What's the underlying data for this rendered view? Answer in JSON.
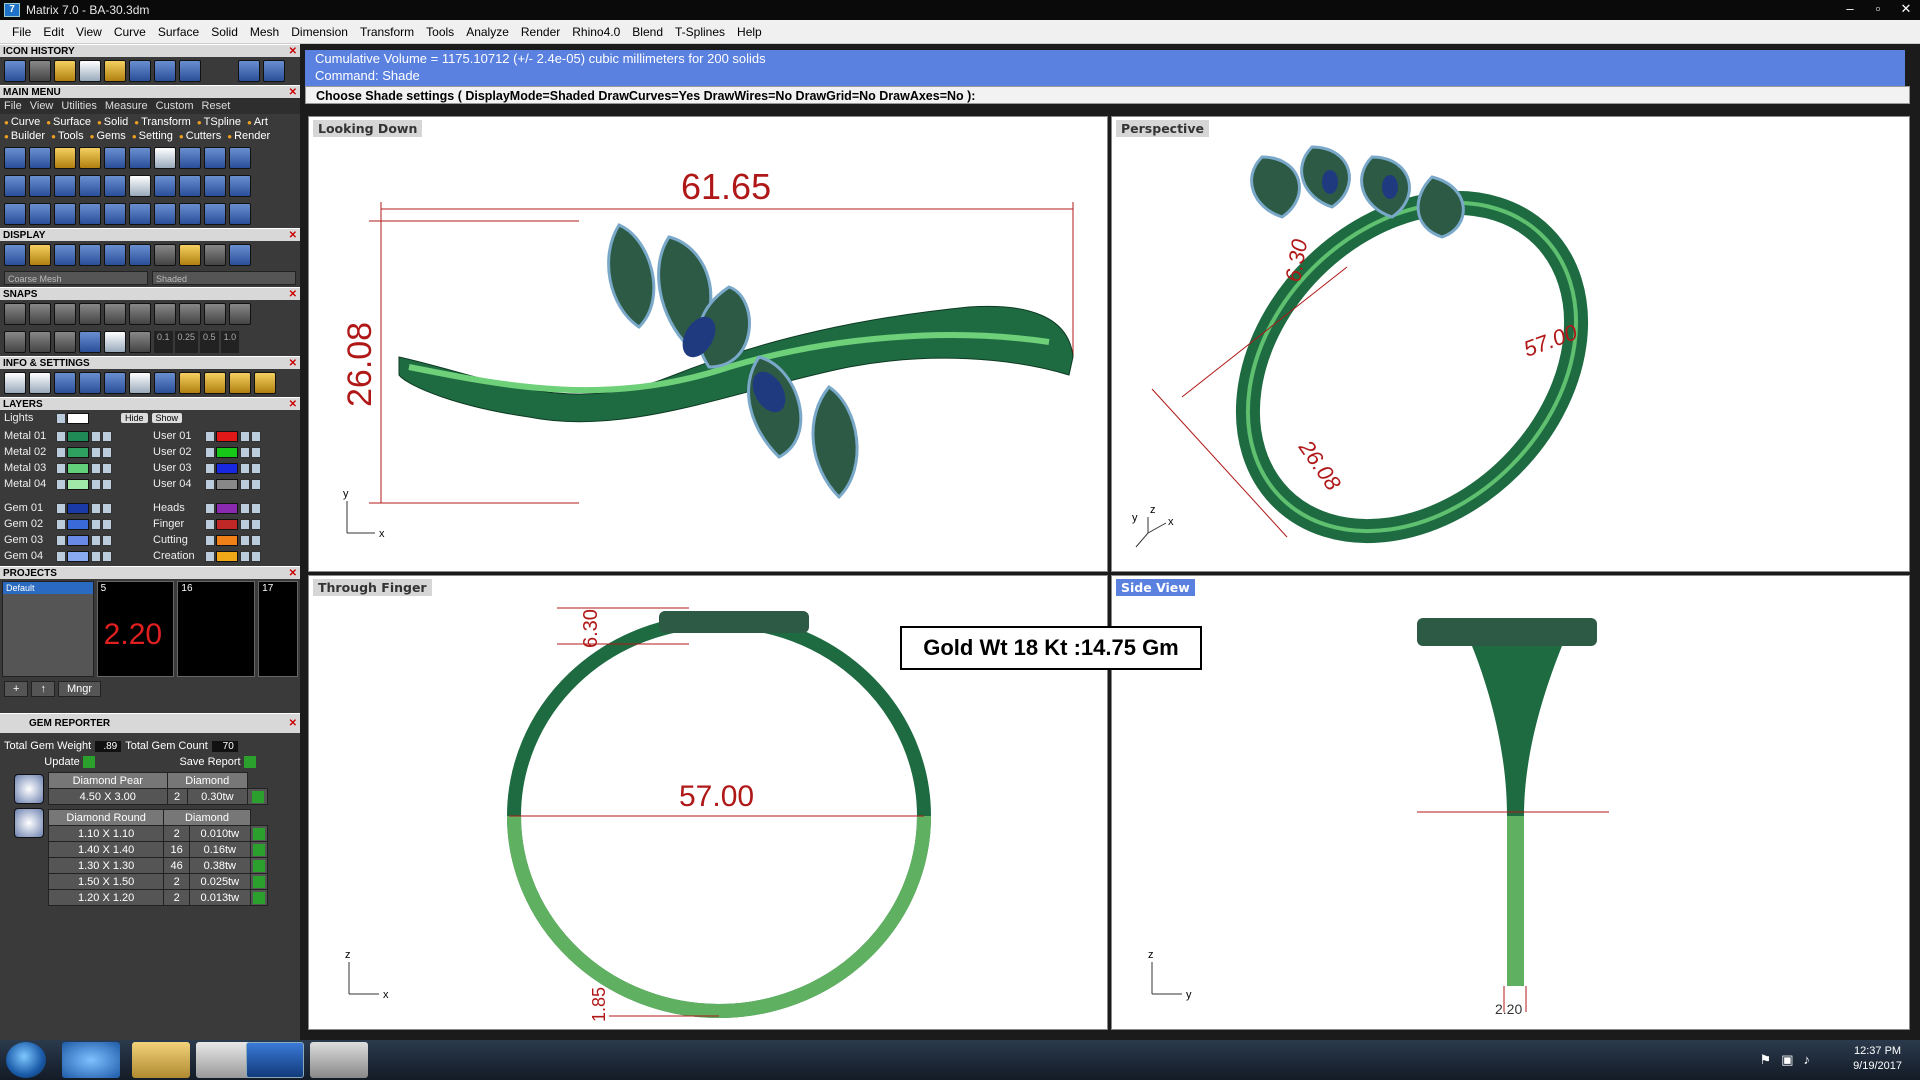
{
  "window": {
    "title": "Matrix 7.0 - BA-30.3dm",
    "icon": "matrix-app-icon"
  },
  "menu": [
    "File",
    "Edit",
    "View",
    "Curve",
    "Surface",
    "Solid",
    "Mesh",
    "Dimension",
    "Transform",
    "Tools",
    "Analyze",
    "Render",
    "Rhino4.0",
    "Blend",
    "T-Splines",
    "Help"
  ],
  "left": {
    "icon_history": "ICON HISTORY",
    "main_menu": "MAIN MENU",
    "submenu": [
      "File",
      "View",
      "Utilities",
      "Measure",
      "Custom",
      "Reset"
    ],
    "categories": [
      "Curve",
      "Surface",
      "Solid",
      "Transform",
      "TSpline",
      "Art",
      "Builder",
      "Tools",
      "Gems",
      "Setting",
      "Cutters",
      "Render"
    ],
    "display": "DISPLAY",
    "display_mesh": "Coarse Mesh",
    "display_mode": "Shaded",
    "snaps": "SNAPS",
    "snap_values": [
      "0.1",
      "0.25",
      "0.5",
      "1.0"
    ],
    "info": "INFO & SETTINGS",
    "layers": "LAYERS",
    "lights": "Lights",
    "hide": "Hide",
    "show": "Show",
    "layers_left": [
      {
        "name": "Metal 01",
        "color": "#1f8a55"
      },
      {
        "name": "Metal 02",
        "color": "#2ea060"
      },
      {
        "name": "Metal 03",
        "color": "#62d07a"
      },
      {
        "name": "Metal 04",
        "color": "#a0e8a8"
      },
      {
        "name": "Gem 01",
        "color": "#1a3aa8"
      },
      {
        "name": "Gem 02",
        "color": "#3a6ad8"
      },
      {
        "name": "Gem 03",
        "color": "#6a8ae8"
      },
      {
        "name": "Gem 04",
        "color": "#8aaaf0"
      }
    ],
    "layers_right": [
      {
        "name": "User 01",
        "color": "#e01818"
      },
      {
        "name": "User 02",
        "color": "#18c818"
      },
      {
        "name": "User 03",
        "color": "#1828e0"
      },
      {
        "name": "User 04",
        "color": "#888888"
      },
      {
        "name": "Heads",
        "color": "#8a2ab0"
      },
      {
        "name": "Finger",
        "color": "#c02828"
      },
      {
        "name": "Cutting",
        "color": "#f08018"
      },
      {
        "name": "Creation",
        "color": "#f0a818"
      }
    ],
    "projects": "PROJECTS",
    "project_default": "Default",
    "thumbs": [
      "5",
      "16",
      "17"
    ],
    "thumb_value": "2.20",
    "mngr": "Mngr",
    "gem_reporter": "GEM REPORTER",
    "total_weight_label": "Total Gem Weight",
    "total_weight": ".89",
    "total_count_label": "Total Gem Count",
    "total_count": "70",
    "update": "Update",
    "save_report": "Save Report",
    "pear": {
      "shape": "Diamond Pear",
      "type": "Diamond",
      "rows": [
        [
          "4.50 X 3.00",
          "2",
          "0.30tw"
        ]
      ]
    },
    "round": {
      "shape": "Diamond Round",
      "type": "Diamond",
      "rows": [
        [
          "1.10 X 1.10",
          "2",
          "0.010tw"
        ],
        [
          "1.40 X 1.40",
          "16",
          "0.16tw"
        ],
        [
          "1.30 X 1.30",
          "46",
          "0.38tw"
        ],
        [
          "1.50 X 1.50",
          "2",
          "0.025tw"
        ],
        [
          "1.20 X 1.20",
          "2",
          "0.013tw"
        ]
      ]
    }
  },
  "command": {
    "line1": "Cumulative Volume = 1175.10712 (+/- 2.4e-05) cubic millimeters for 200 solids",
    "line2": "Command: Shade",
    "prompt": "Choose Shade settings ( DisplayMode=Shaded  DrawCurves=Yes  DrawWires=No  DrawGrid=No  DrawAxes=No ):"
  },
  "viewports": {
    "top_left": {
      "label": "Looking Down",
      "width_dim": "61.65",
      "height_dim": "26.08",
      "axis_y": "y",
      "axis_x": "x"
    },
    "top_right": {
      "label": "Perspective",
      "dim_a": "6.30",
      "dim_b": "57.00",
      "dim_c": "26.08",
      "axis_y": "y",
      "axis_x": "x",
      "axis_z": "z"
    },
    "bottom_left": {
      "label": "Through Finger",
      "dim_a": "6.30",
      "dim_b": "57.00",
      "dim_c": "1.85",
      "axis_z": "z",
      "axis_x": "x"
    },
    "bottom_right": {
      "label": "Side View",
      "dim_a": "2.20",
      "axis_z": "z",
      "axis_y": "y"
    }
  },
  "gold_weight": "Gold Wt 18 Kt :14.75 Gm",
  "taskbar": {
    "time": "12:37 PM",
    "date": "9/19/2017"
  }
}
